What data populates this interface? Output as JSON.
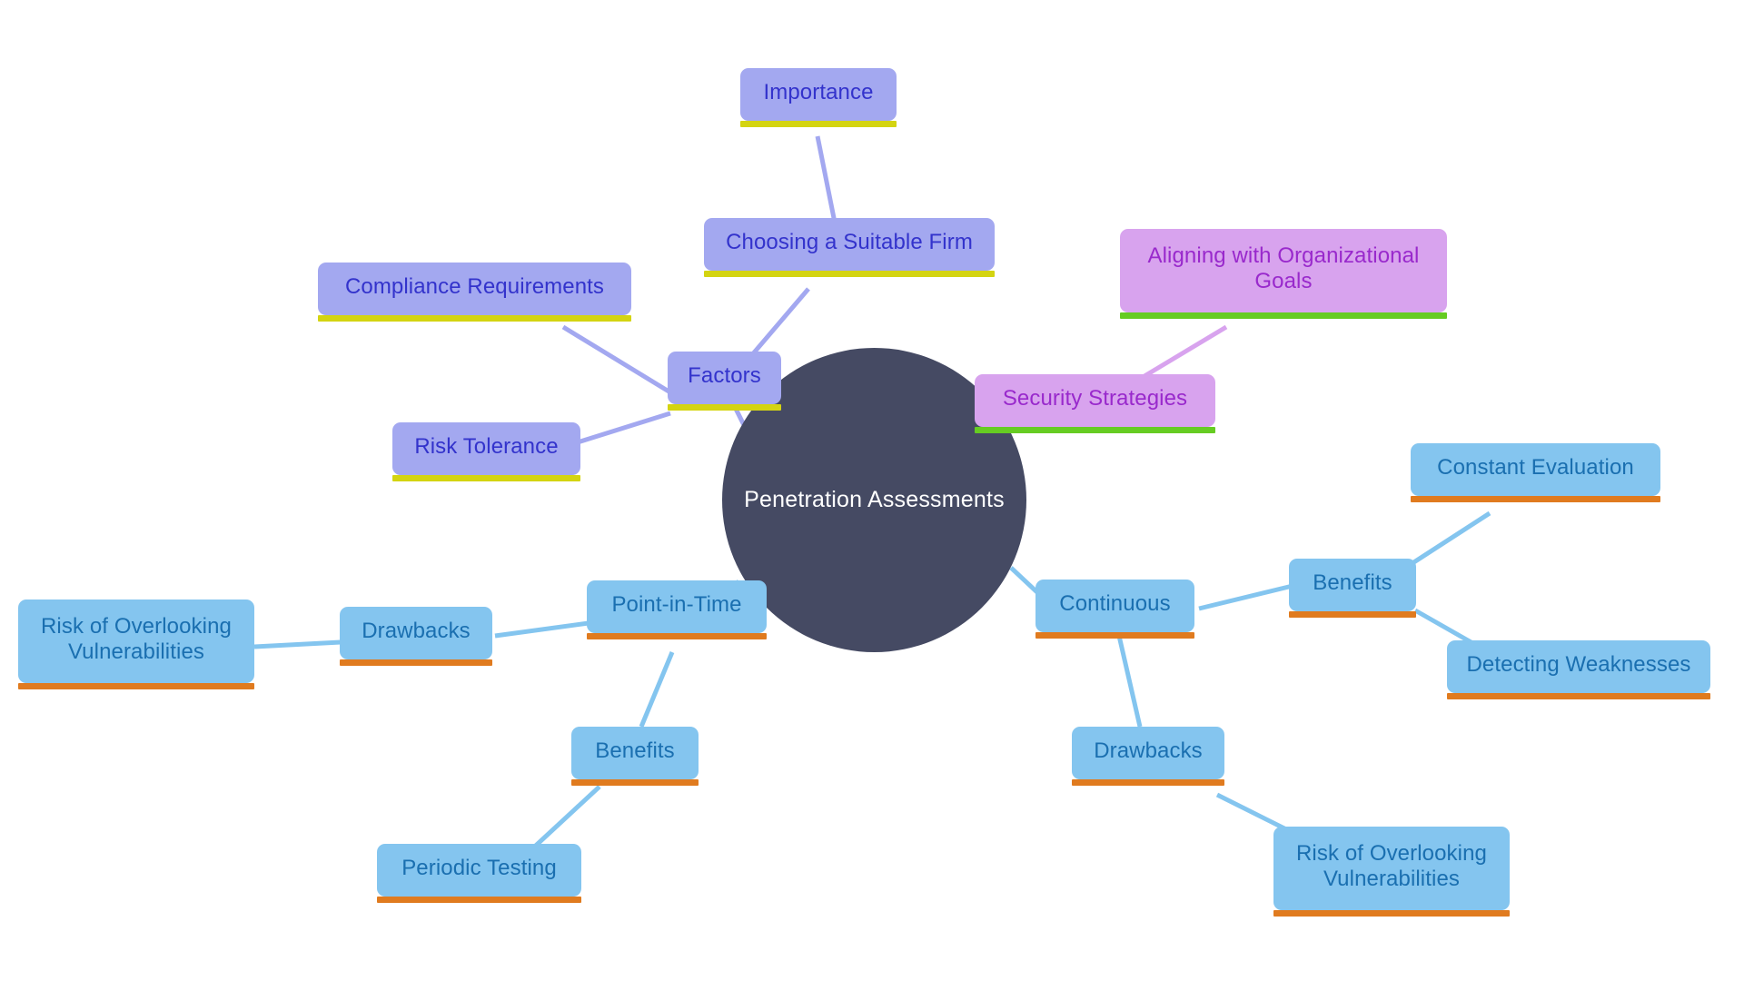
{
  "diagram": {
    "type": "mind-map",
    "title": "Penetration Assessments",
    "background": "#ffffff",
    "palette": {
      "root_fill": "#454a63",
      "root_text": "#ffffff",
      "periwinkle_fill": "#a3a8f0",
      "periwinkle_text": "#3333cc",
      "periwinkle_underline": "#d4d411",
      "orchid_fill": "#d8a3ee",
      "orchid_text": "#9929cc",
      "orchid_underline": "#66cc22",
      "sky_fill": "#84c5ef",
      "sky_text": "#1a6fb0",
      "sky_underline": "#e07b1f"
    }
  },
  "root": {
    "label": "Penetration Assessments"
  },
  "nodes": {
    "factors": "Factors",
    "compliance_requirements": "Compliance Requirements",
    "risk_tolerance": "Risk Tolerance",
    "choosing_firm": "Choosing a Suitable Firm",
    "importance": "Importance",
    "security_strategies": "Security Strategies",
    "aligning_goals": "Aligning with Organizational\nGoals",
    "point_in_time": "Point-in-Time",
    "pit_drawbacks": "Drawbacks",
    "pit_risk_overlooking": "Risk of Overlooking\nVulnerabilities",
    "pit_benefits": "Benefits",
    "periodic_testing": "Periodic Testing",
    "continuous": "Continuous",
    "cont_benefits": "Benefits",
    "constant_evaluation": "Constant Evaluation",
    "detecting_weaknesses": "Detecting Weaknesses",
    "cont_drawbacks": "Drawbacks",
    "cont_risk_overlooking": "Risk of Overlooking\nVulnerabilities"
  },
  "edges": [
    {
      "from": "root",
      "to": "factors",
      "color": "#a3a8f0"
    },
    {
      "from": "factors",
      "to": "compliance_requirements",
      "color": "#a3a8f0"
    },
    {
      "from": "factors",
      "to": "risk_tolerance",
      "color": "#a3a8f0"
    },
    {
      "from": "factors",
      "to": "choosing_firm",
      "color": "#a3a8f0"
    },
    {
      "from": "choosing_firm",
      "to": "importance",
      "color": "#a3a8f0"
    },
    {
      "from": "root",
      "to": "security_strategies",
      "color": "#d8a3ee"
    },
    {
      "from": "security_strategies",
      "to": "aligning_goals",
      "color": "#d8a3ee"
    },
    {
      "from": "root",
      "to": "point_in_time",
      "color": "#84c5ef"
    },
    {
      "from": "point_in_time",
      "to": "pit_drawbacks",
      "color": "#84c5ef"
    },
    {
      "from": "pit_drawbacks",
      "to": "pit_risk_overlooking",
      "color": "#84c5ef"
    },
    {
      "from": "point_in_time",
      "to": "pit_benefits",
      "color": "#84c5ef"
    },
    {
      "from": "pit_benefits",
      "to": "periodic_testing",
      "color": "#84c5ef"
    },
    {
      "from": "root",
      "to": "continuous",
      "color": "#84c5ef"
    },
    {
      "from": "continuous",
      "to": "cont_benefits",
      "color": "#84c5ef"
    },
    {
      "from": "cont_benefits",
      "to": "constant_evaluation",
      "color": "#84c5ef"
    },
    {
      "from": "cont_benefits",
      "to": "detecting_weaknesses",
      "color": "#84c5ef"
    },
    {
      "from": "continuous",
      "to": "cont_drawbacks",
      "color": "#84c5ef"
    },
    {
      "from": "cont_drawbacks",
      "to": "cont_risk_overlooking",
      "color": "#84c5ef"
    }
  ]
}
